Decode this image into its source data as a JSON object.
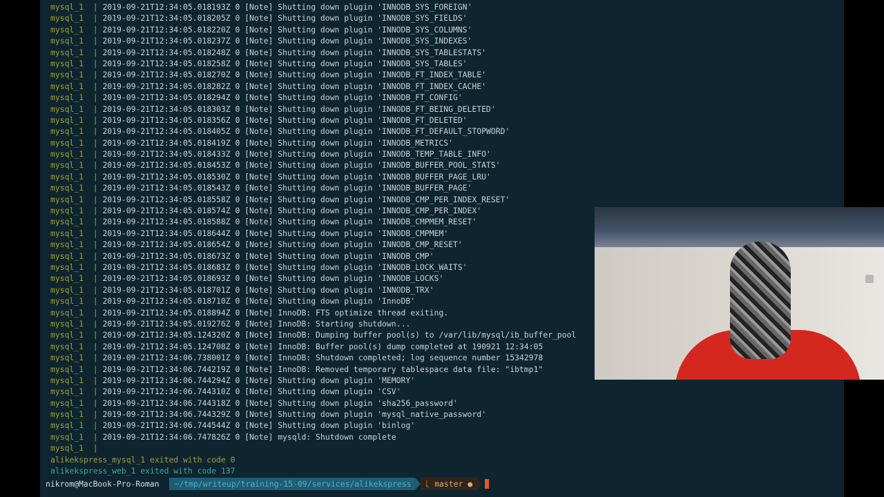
{
  "log": {
    "service": "mysql_1",
    "separator": "|",
    "lines": [
      "2019-09-21T12:34:05.018193Z 0 [Note] Shutting down plugin 'INNODB_SYS_FOREIGN'",
      "2019-09-21T12:34:05.018205Z 0 [Note] Shutting down plugin 'INNODB_SYS_FIELDS'",
      "2019-09-21T12:34:05.018220Z 0 [Note] Shutting down plugin 'INNODB_SYS_COLUMNS'",
      "2019-09-21T12:34:05.018237Z 0 [Note] Shutting down plugin 'INNODB_SYS_INDEXES'",
      "2019-09-21T12:34:05.018248Z 0 [Note] Shutting down plugin 'INNODB_SYS_TABLESTATS'",
      "2019-09-21T12:34:05.018258Z 0 [Note] Shutting down plugin 'INNODB_SYS_TABLES'",
      "2019-09-21T12:34:05.018270Z 0 [Note] Shutting down plugin 'INNODB_FT_INDEX_TABLE'",
      "2019-09-21T12:34:05.018282Z 0 [Note] Shutting down plugin 'INNODB_FT_INDEX_CACHE'",
      "2019-09-21T12:34:05.018294Z 0 [Note] Shutting down plugin 'INNODB_FT_CONFIG'",
      "2019-09-21T12:34:05.018303Z 0 [Note] Shutting down plugin 'INNODB_FT_BEING_DELETED'",
      "2019-09-21T12:34:05.018356Z 0 [Note] Shutting down plugin 'INNODB_FT_DELETED'",
      "2019-09-21T12:34:05.018405Z 0 [Note] Shutting down plugin 'INNODB_FT_DEFAULT_STOPWORD'",
      "2019-09-21T12:34:05.018419Z 0 [Note] Shutting down plugin 'INNODB_METRICS'",
      "2019-09-21T12:34:05.018433Z 0 [Note] Shutting down plugin 'INNODB_TEMP_TABLE_INFO'",
      "2019-09-21T12:34:05.018453Z 0 [Note] Shutting down plugin 'INNODB_BUFFER_POOL_STATS'",
      "2019-09-21T12:34:05.018530Z 0 [Note] Shutting down plugin 'INNODB_BUFFER_PAGE_LRU'",
      "2019-09-21T12:34:05.018543Z 0 [Note] Shutting down plugin 'INNODB_BUFFER_PAGE'",
      "2019-09-21T12:34:05.018558Z 0 [Note] Shutting down plugin 'INNODB_CMP_PER_INDEX_RESET'",
      "2019-09-21T12:34:05.018574Z 0 [Note] Shutting down plugin 'INNODB_CMP_PER_INDEX'",
      "2019-09-21T12:34:05.018588Z 0 [Note] Shutting down plugin 'INNODB_CMPMEM_RESET'",
      "2019-09-21T12:34:05.018644Z 0 [Note] Shutting down plugin 'INNODB_CMPMEM'",
      "2019-09-21T12:34:05.018654Z 0 [Note] Shutting down plugin 'INNODB_CMP_RESET'",
      "2019-09-21T12:34:05.018673Z 0 [Note] Shutting down plugin 'INNODB_CMP'",
      "2019-09-21T12:34:05.018683Z 0 [Note] Shutting down plugin 'INNODB_LOCK_WAITS'",
      "2019-09-21T12:34:05.018693Z 0 [Note] Shutting down plugin 'INNODB_LOCKS'",
      "2019-09-21T12:34:05.018701Z 0 [Note] Shutting down plugin 'INNODB_TRX'",
      "2019-09-21T12:34:05.018710Z 0 [Note] Shutting down plugin 'InnoDB'",
      "2019-09-21T12:34:05.018894Z 0 [Note] InnoDB: FTS optimize thread exiting.",
      "2019-09-21T12:34:05.019276Z 0 [Note] InnoDB: Starting shutdown...",
      "2019-09-21T12:34:05.124320Z 0 [Note] InnoDB: Dumping buffer pool(s) to /var/lib/mysql/ib_buffer_pool",
      "2019-09-21T12:34:05.124708Z 0 [Note] InnoDB: Buffer pool(s) dump completed at 190921 12:34:05",
      "2019-09-21T12:34:06.738001Z 0 [Note] InnoDB: Shutdown completed; log sequence number 15342978",
      "2019-09-21T12:34:06.744219Z 0 [Note] InnoDB: Removed temporary tablespace data file: \"ibtmp1\"",
      "2019-09-21T12:34:06.744294Z 0 [Note] Shutting down plugin 'MEMORY'",
      "2019-09-21T12:34:06.744310Z 0 [Note] Shutting down plugin 'CSV'",
      "2019-09-21T12:34:06.744318Z 0 [Note] Shutting down plugin 'sha256_password'",
      "2019-09-21T12:34:06.744329Z 0 [Note] Shutting down plugin 'mysql_native_password'",
      "2019-09-21T12:34:06.744544Z 0 [Note] Shutting down plugin 'binlog'",
      "2019-09-21T12:34:06.747826Z 0 [Note] mysqld: Shutdown complete",
      ""
    ]
  },
  "exit_messages": {
    "mysql": "alikekspress_mysql_1 exited with code 0",
    "web": "alikekspress_web_1 exited with code 137"
  },
  "prompt": {
    "user_host": "nikrom@MacBook-Pro-Roman",
    "path": "~/tmp/writeup/training-15-09/services/alikekspress",
    "branch_icon": "ᚳ",
    "branch": "master",
    "dirty_marker": "●"
  },
  "colors": {
    "terminal_bg": "#0e2530",
    "service_label": "#a2a12a",
    "text": "#c9d3d6",
    "exit_mysql": "#a79a3e",
    "exit_web": "#3fa3a5",
    "cursor": "#e05a1e",
    "path_segment": "#1f5d72",
    "git_segment": "#30241a"
  }
}
